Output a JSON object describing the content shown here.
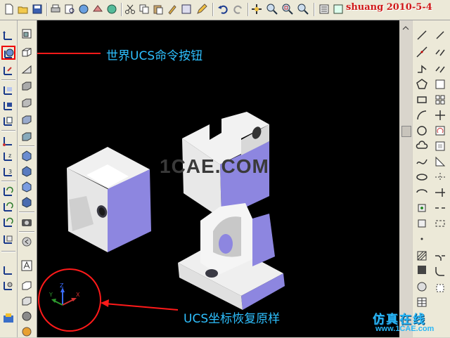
{
  "watermark_top": "shuang 2010-5-4",
  "canvas_watermark": "1CAE.COM",
  "annotations": {
    "world_ucs_button": "世界UCS命令按钮",
    "ucs_restore": "UCS坐标恢复原样"
  },
  "ucs_icon": {
    "x_label": "X",
    "y_label": "Y",
    "z_label": "Z"
  },
  "footer": {
    "brand": "仿真在线",
    "url": "www.1CAE.com"
  },
  "colors": {
    "canvas_bg": "#000000",
    "annotation": "#2ec0ff",
    "highlight_circle": "#ff1a1a",
    "arrow": "#ff1a1a",
    "part_light": "#f0f0f0",
    "part_shade": "#8d86e0"
  },
  "top_toolbar": [
    "new-icon",
    "open-icon",
    "save-icon",
    "print-icon",
    "plot-preview-icon",
    "publish-icon",
    "3d-dwf-icon",
    "cut-icon",
    "copy-icon",
    "paste-icon",
    "match-properties-icon",
    "block-editor-icon",
    "undo-icon",
    "redo-icon",
    "pan-icon",
    "zoom-realtime-icon",
    "zoom-window-icon",
    "zoom-previous-icon"
  ],
  "left_toolbar_1": [
    "ucs-icon",
    "world-ucs-icon",
    "ucs-previous-icon",
    "face-ucs-icon",
    "object-ucs-icon",
    "view-ucs-icon",
    "origin-ucs-icon",
    "z-axis-vector-icon",
    "3point-ucs-icon",
    "x-rotate-icon",
    "y-rotate-icon",
    "z-rotate-icon",
    "apply-ucs-icon",
    "named-ucs-icon",
    "ucs-settings-icon"
  ],
  "left_toolbar_2": [
    "polysolid-icon",
    "box-icon",
    "wedge-icon",
    "cone-icon",
    "sphere-icon",
    "cylinder-icon",
    "torus-icon",
    "pyramid-icon",
    "helix-icon",
    "planar-surface-icon",
    "extrude-icon",
    "revolve-icon",
    "sweep-icon",
    "loft-icon",
    "text-icon",
    "solid-box-icon",
    "shade-icon"
  ],
  "right_toolbar": [
    "line-icon",
    "construction-line-icon",
    "polyline-icon",
    "polygon-icon",
    "rectangle-icon",
    "arc-icon",
    "circle-icon",
    "revision-cloud-icon",
    "spline-icon",
    "ellipse-icon",
    "ellipse-arc-icon",
    "insert-block-icon",
    "make-block-icon",
    "point-icon",
    "hatch-icon",
    "gradient-icon",
    "region-icon",
    "table-icon",
    "multiline-text-icon"
  ],
  "modify_toolbar": [
    "erase-icon",
    "copy-object-icon",
    "mirror-icon",
    "offset-icon",
    "array-icon",
    "move-icon",
    "rotate-icon",
    "scale-icon",
    "stretch-icon",
    "trim-icon",
    "extend-icon",
    "break-icon",
    "join-icon",
    "chamfer-icon",
    "fillet-icon",
    "explode-icon"
  ]
}
